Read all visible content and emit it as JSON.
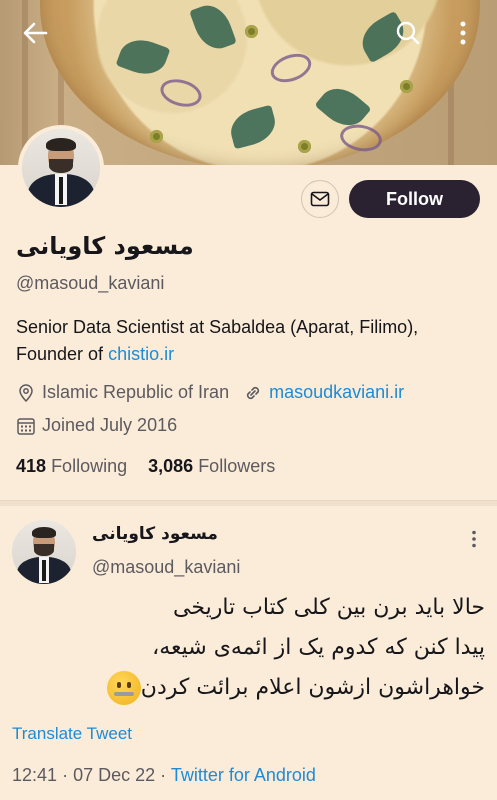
{
  "banner": {
    "back_icon": "arrow-left-icon",
    "search_icon": "search-icon",
    "more_icon": "more-vertical-icon"
  },
  "profile": {
    "display_name": "مسعود کاویانی",
    "handle": "@masoud_kaviani",
    "bio_text": "Senior Data Scientist at Sabaldea (Aparat, Filimo), Founder of ",
    "bio_link": "chistio.ir",
    "location": "Islamic Republic of Iran",
    "website": "masoudkaviani.ir",
    "joined": "Joined July 2016",
    "following_count": "418",
    "following_label": "Following",
    "followers_count": "3,086",
    "followers_label": "Followers",
    "follow_label": "Follow",
    "message_icon": "mail-icon"
  },
  "tweet": {
    "author_name": "مسعود کاویانی",
    "author_handle": "@masoud_kaviani",
    "lines": [
      "حالا باید برن بین کلی کتاب تاریخی",
      "پیدا کنن که کدوم یک از ائمه‌ی شیعه،",
      "خواهراشون ازشون اعلام برائت کردن"
    ],
    "emoji": "zipper-mouth-face",
    "translate_label": "Translate Tweet",
    "time": "12:41",
    "date": "07 Dec 22",
    "source": "Twitter for Android"
  },
  "colors": {
    "background": "#faecd9",
    "accent": "#1d8bd6",
    "follow_button": "#2a2230"
  }
}
